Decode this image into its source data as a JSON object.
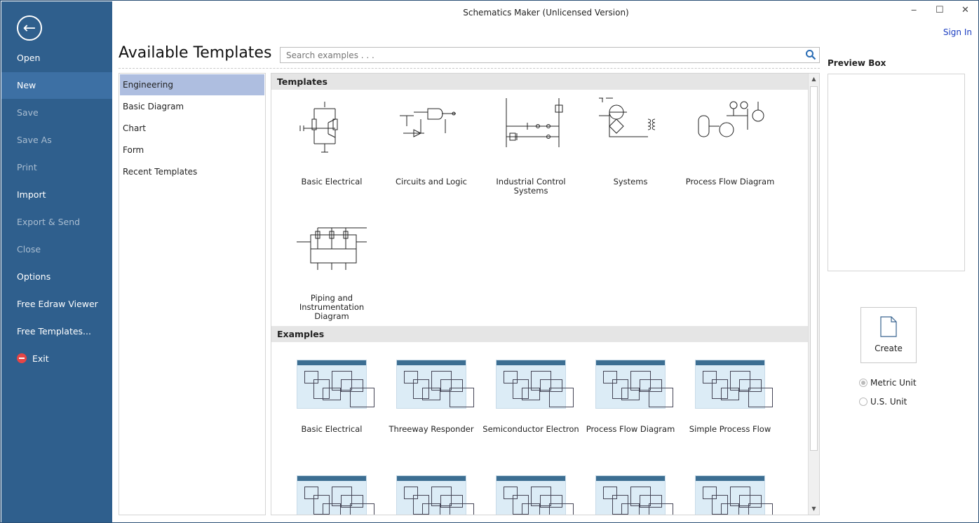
{
  "window": {
    "title": "Schematics Maker (Unlicensed Version)",
    "sign_in": "Sign In",
    "minimize": "‒",
    "maximize": "☐",
    "close": "✕"
  },
  "sidebar": {
    "back_icon": "←",
    "items": [
      {
        "label": "Open",
        "enabled": true
      },
      {
        "label": "New",
        "enabled": true,
        "selected": true
      },
      {
        "label": "Save",
        "enabled": false
      },
      {
        "label": "Save As",
        "enabled": false
      },
      {
        "label": "Print",
        "enabled": false
      },
      {
        "label": "Import",
        "enabled": true
      },
      {
        "label": "Export & Send",
        "enabled": false
      },
      {
        "label": "Close",
        "enabled": false
      },
      {
        "label": "Options",
        "enabled": true
      },
      {
        "label": "Free Edraw Viewer",
        "enabled": true
      },
      {
        "label": "Free Templates...",
        "enabled": true
      },
      {
        "label": "Exit",
        "enabled": true,
        "icon": "exit-icon"
      }
    ]
  },
  "header": {
    "title": "Available Templates",
    "search_placeholder": "Search examples . . ."
  },
  "categories": [
    "Engineering",
    "Basic Diagram",
    "Chart",
    "Form",
    "Recent Templates"
  ],
  "templates": {
    "title": "Templates",
    "items": [
      "Basic Electrical",
      "Circuits and Logic",
      "Industrial Control Systems",
      "Systems",
      "Process Flow Diagram",
      "Piping and Instrumentation Diagram"
    ]
  },
  "examples": {
    "title": "Examples",
    "items": [
      "Basic Electrical",
      "Threeway Responder",
      "Semiconductor Electron",
      "Process Flow Diagram",
      "Simple Process Flow",
      "",
      "",
      "",
      "",
      ""
    ]
  },
  "preview": {
    "title": "Preview Box",
    "create": "Create",
    "units": [
      {
        "label": "Metric Unit",
        "selected": true
      },
      {
        "label": "U.S. Unit",
        "selected": false
      }
    ]
  },
  "colors": {
    "sidebar": "#2f5f8d",
    "sidebar_selected": "#3d70a4",
    "category_selected": "#aebee0",
    "link": "#1a3cc0"
  }
}
